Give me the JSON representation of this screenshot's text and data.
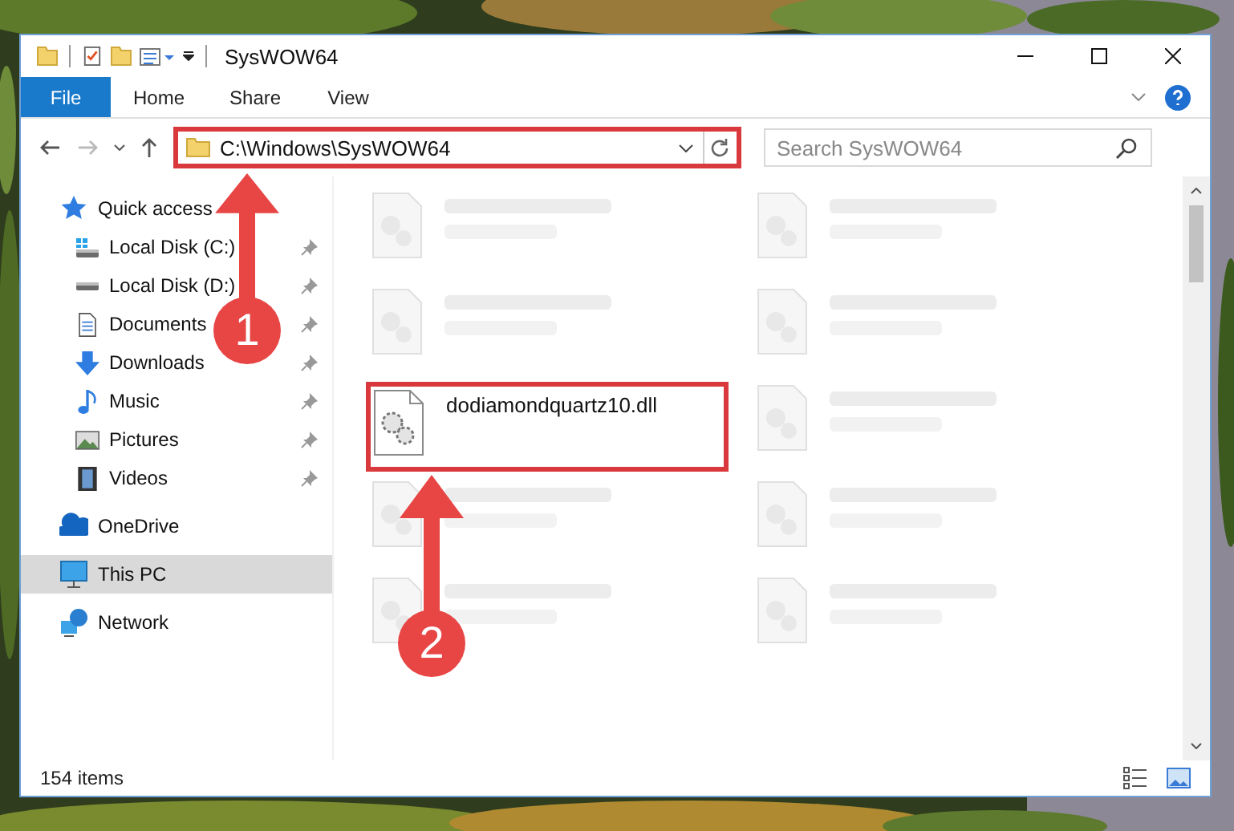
{
  "window": {
    "title": "SysWOW64"
  },
  "ribbon_tabs": [
    {
      "label": "File",
      "selected": true
    },
    {
      "label": "Home",
      "selected": false
    },
    {
      "label": "Share",
      "selected": false
    },
    {
      "label": "View",
      "selected": false
    }
  ],
  "address": {
    "path": "C:\\Windows\\SysWOW64",
    "highlighted": true
  },
  "search": {
    "placeholder": "Search SysWOW64"
  },
  "sidebar": [
    {
      "label": "Quick access",
      "kind": "star",
      "selected": false,
      "children": [
        {
          "label": "Local Disk (C:)",
          "kind": "disk-c",
          "pinned": true,
          "selected": false
        },
        {
          "label": "Local Disk (D:)",
          "kind": "disk",
          "pinned": true,
          "selected": false
        },
        {
          "label": "Documents",
          "kind": "documents",
          "pinned": true,
          "selected": false
        },
        {
          "label": "Downloads",
          "kind": "downloads",
          "pinned": true,
          "selected": false
        },
        {
          "label": "Music",
          "kind": "music",
          "pinned": true,
          "selected": false
        },
        {
          "label": "Pictures",
          "kind": "pictures",
          "pinned": true,
          "selected": false
        },
        {
          "label": "Videos",
          "kind": "videos",
          "pinned": true,
          "selected": false
        }
      ]
    },
    {
      "label": "OneDrive",
      "kind": "cloud",
      "selected": false
    },
    {
      "label": "This PC",
      "kind": "pc",
      "selected": true
    },
    {
      "label": "Network",
      "kind": "network",
      "selected": false
    }
  ],
  "files": [
    {
      "kind": "blurred"
    },
    {
      "kind": "blurred"
    },
    {
      "kind": "blurred"
    },
    {
      "kind": "blurred"
    },
    {
      "kind": "file",
      "name": "dodiamondquartz10.dll",
      "highlighted": true
    },
    {
      "kind": "blurred"
    },
    {
      "kind": "blurred"
    },
    {
      "kind": "blurred"
    },
    {
      "kind": "blurred"
    },
    {
      "kind": "blurred"
    }
  ],
  "status_bar": {
    "item_count": "154 items"
  },
  "callouts": [
    {
      "number": "1"
    },
    {
      "number": "2"
    }
  ]
}
